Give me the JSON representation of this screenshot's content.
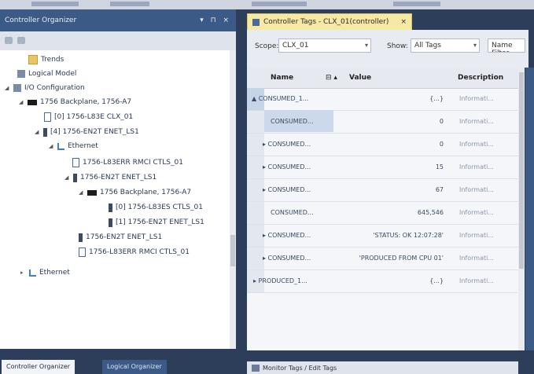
{
  "left_panel": {
    "title": "Controller Organizer",
    "window_controls": "▾ ⊓ ×",
    "tree": [
      {
        "label": "Trends",
        "icon": "folder-icon"
      },
      {
        "label": "Logical Model",
        "icon": "logical-model-icon"
      },
      {
        "label": "I/O Configuration",
        "icon": "io-config-icon"
      },
      {
        "label": "1756 Backplane, 1756-A7",
        "icon": "chassis-icon"
      },
      {
        "label": "[0] 1756-L83E CLX_01",
        "icon": "controller-icon"
      },
      {
        "label": "[4] 1756-EN2T ENET_LS1",
        "icon": "module-icon"
      },
      {
        "label": "Ethernet",
        "icon": "ethernet-icon"
      },
      {
        "label": "1756-L83ERR RMCI CTLS_01",
        "icon": "module-icon"
      },
      {
        "label": "1756-EN2T ENET_LS1",
        "icon": "module-icon"
      },
      {
        "label": "1756 Backplane, 1756-A7",
        "icon": "chassis-icon"
      },
      {
        "label": "[0] 1756-L83ES CTLS_01",
        "icon": "module-icon"
      },
      {
        "label": "[1] 1756-EN2T ENET_LS1",
        "icon": "module-icon"
      },
      {
        "label": "1756-EN2T ENET_LS1",
        "icon": "module-icon"
      },
      {
        "label": "1756-L83ERR RMCI CTLS_01",
        "icon": "module-icon"
      },
      {
        "label": "Ethernet",
        "icon": "ethernet-icon"
      }
    ],
    "tabs": [
      "Controller Organizer",
      "Logical Organizer"
    ]
  },
  "right_panel": {
    "doc_tab_title": "Controller Tags - CLX_01(controller)",
    "doc_tab_close": "×",
    "filter": {
      "scope_label": "Scope:",
      "scope_value": "CLX_01",
      "show_label": "Show:",
      "show_value": "All Tags",
      "extra_label": "Enter Name Filter..."
    },
    "grid": {
      "columns": [
        "Name",
        "Value",
        "Description"
      ],
      "rows": [
        {
          "name": "▲ CONSUMED_1...",
          "value": "{...}",
          "desc": "Informati..."
        },
        {
          "name": "CONSUMED...",
          "value": "0",
          "desc": "Informati..."
        },
        {
          "name": "▸ CONSUMED...",
          "value": "0",
          "desc": "Informati..."
        },
        {
          "name": "▸ CONSUMED...",
          "value": "15",
          "desc": "Informati..."
        },
        {
          "name": "▸ CONSUMED...",
          "value": "67",
          "desc": "Informati..."
        },
        {
          "name": "CONSUMED...",
          "value": "645,546",
          "desc": "Informati..."
        },
        {
          "name": "▸ CONSUMED...",
          "value": "'STATUS: OK 12:07:28'",
          "desc": "Informati..."
        },
        {
          "name": "▸ CONSUMED...",
          "value": "'PRODUCED FROM CPU 01'",
          "desc": "Informati..."
        },
        {
          "name": "▸ PRODUCED_1...",
          "value": "{...}",
          "desc": "Informati..."
        }
      ]
    },
    "bottom_bar_text": "Monitor Tags  /  Edit Tags"
  }
}
